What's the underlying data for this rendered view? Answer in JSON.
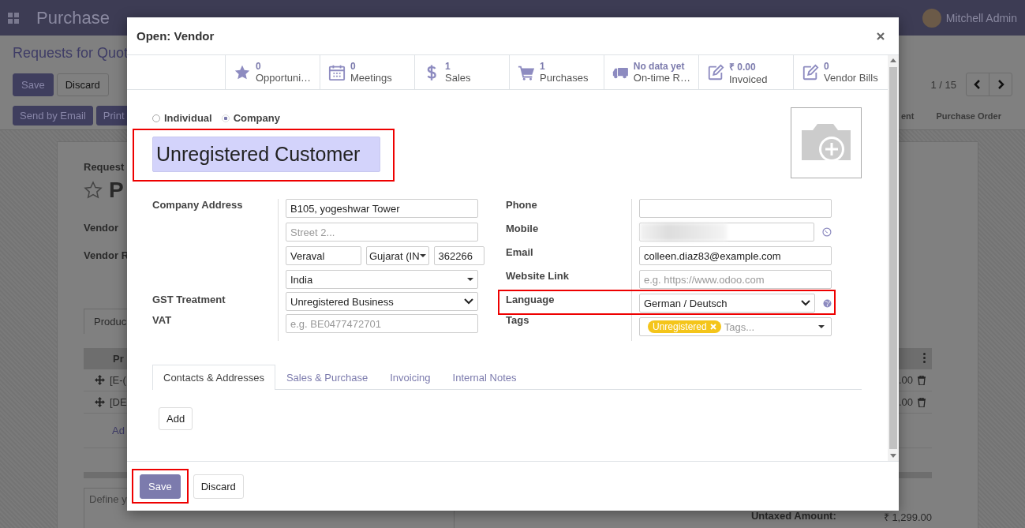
{
  "navbar": {
    "app": "Purchase",
    "user": "Mitchell Admin"
  },
  "control_panel": {
    "breadcrumb": "Requests for Quot",
    "buttons": [
      "Save",
      "Discard"
    ],
    "actions": [
      "Send by Email",
      "Print"
    ],
    "pager": "1 / 15",
    "stages": [
      "ent",
      "Purchase Order"
    ]
  },
  "sheet": {
    "subtitle": "Request",
    "title": "P",
    "fields": [
      "Vendor",
      "Vendor R"
    ],
    "tab": "Produc",
    "table_header": "Pr",
    "rows": [
      {
        "product": "[E-(",
        "amount": ".00"
      },
      {
        "product": "[DE",
        "amount": ".00"
      }
    ],
    "add_line": "Ad",
    "notes_placeholder": "Define y",
    "totals": [
      {
        "label": "Untaxed Amount:",
        "value": "₹ 1,299.00"
      }
    ]
  },
  "dialog": {
    "title": "Open: Vendor",
    "stat_buttons": [
      {
        "kind": "star",
        "value": "0",
        "label": "Opportuni…"
      },
      {
        "kind": "calendar",
        "value": "0",
        "label": "Meetings"
      },
      {
        "kind": "dollar",
        "value": "1",
        "label": "Sales"
      },
      {
        "kind": "cart",
        "value": "1",
        "label": "Purchases"
      },
      {
        "kind": "truck",
        "value": "No data yet",
        "label": "On-time R…"
      },
      {
        "kind": "edit",
        "value": "₹ 0.00",
        "label": "Invoiced"
      },
      {
        "kind": "edit",
        "value": "0",
        "label": "Vendor Bills"
      }
    ],
    "company_type": [
      {
        "label": "Individual",
        "selected": false
      },
      {
        "label": "Company",
        "selected": true
      }
    ],
    "name": "Unregistered Customer",
    "address": {
      "label": "Company Address",
      "street": "B105, yogeshwar Tower",
      "street2_placeholder": "Street 2...",
      "city": "Veraval",
      "state": "Gujarat (IN",
      "zip": "362266",
      "country": "India"
    },
    "gst": {
      "label": "GST Treatment",
      "value": "Unregistered Business"
    },
    "vat": {
      "label": "VAT",
      "placeholder": "e.g. BE0477472701"
    },
    "right_fields": [
      {
        "kind": "text",
        "label": "Phone"
      },
      {
        "kind": "mobile",
        "label": "Mobile"
      },
      {
        "kind": "text",
        "label": "Email",
        "value": "colleen.diaz83@example.com"
      },
      {
        "kind": "text",
        "label": "Website Link",
        "placeholder": "e.g. https://www.odoo.com"
      },
      {
        "kind": "select",
        "label": "Language",
        "value": "German / Deutsch"
      },
      {
        "kind": "tags",
        "label": "Tags",
        "tags": [
          "Unregistered"
        ],
        "placeholder": "Tags..."
      }
    ],
    "tabs": [
      {
        "label": "Contacts & Addresses",
        "selected": true
      },
      {
        "label": "Sales & Purchase",
        "selected": false
      },
      {
        "label": "Invoicing",
        "selected": false
      },
      {
        "label": "Internal Notes",
        "selected": false
      }
    ],
    "add_button": "Add",
    "footer": [
      {
        "kind": "primary",
        "label": "Save"
      },
      {
        "kind": "secondary",
        "label": "Discard"
      }
    ]
  }
}
